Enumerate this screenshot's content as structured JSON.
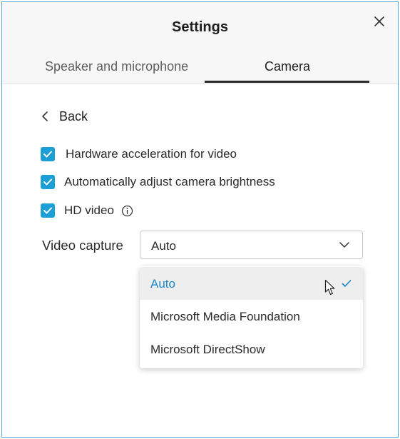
{
  "dialog": {
    "title": "Settings",
    "close_icon": "close-icon"
  },
  "tabs": [
    {
      "label": "Speaker and microphone",
      "active": false
    },
    {
      "label": "Camera",
      "active": true
    }
  ],
  "back": {
    "label": "Back",
    "icon": "chevron-left-icon"
  },
  "options": [
    {
      "label": "Hardware acceleration for video",
      "checked": true
    },
    {
      "label": "Automatically adjust camera brightness",
      "checked": true
    },
    {
      "label": "HD video",
      "checked": true,
      "info_icon": "info-icon"
    }
  ],
  "video_capture": {
    "label": "Video capture",
    "selected": "Auto",
    "options": [
      {
        "label": "Auto",
        "selected": true
      },
      {
        "label": "Microsoft Media Foundation",
        "selected": false
      },
      {
        "label": "Microsoft DirectShow",
        "selected": false
      }
    ]
  },
  "colors": {
    "accent": "#1b9fd6",
    "selected_text": "#1b87c9",
    "window_border": "#4aa8de"
  }
}
